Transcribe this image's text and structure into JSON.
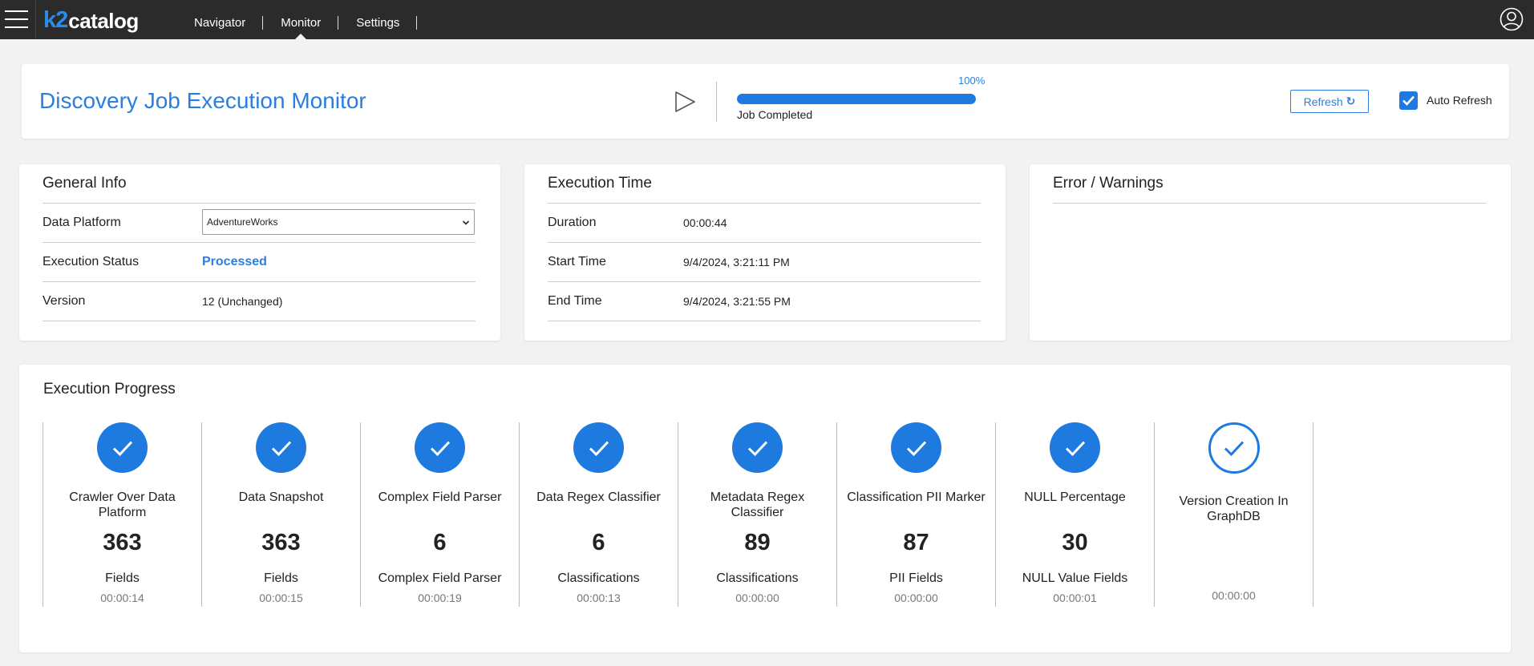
{
  "app": {
    "logo_k2": "k2",
    "logo_catalog": "catalog",
    "nav": [
      "Navigator",
      "Monitor",
      "Settings"
    ],
    "active_nav": "Monitor"
  },
  "header": {
    "title": "Discovery Job Execution Monitor",
    "progress_percent": 100,
    "progress_label": "100%",
    "status_label": "Job Completed",
    "refresh_label": "Refresh",
    "auto_refresh_label": "Auto Refresh",
    "auto_refresh_checked": true
  },
  "general_info": {
    "title": "General Info",
    "data_platform_label": "Data Platform",
    "data_platform_value": "AdventureWorks",
    "execution_status_label": "Execution Status",
    "execution_status_value": "Processed",
    "version_label": "Version",
    "version_value": "12 (Unchanged)"
  },
  "execution_time": {
    "title": "Execution Time",
    "duration_label": "Duration",
    "duration_value": "00:00:44",
    "start_label": "Start Time",
    "start_value": "9/4/2024, 3:21:11 PM",
    "end_label": "End Time",
    "end_value": "9/4/2024, 3:21:55 PM"
  },
  "errors": {
    "title": "Error / Warnings"
  },
  "execution_progress": {
    "title": "Execution Progress",
    "steps": [
      {
        "name": "Crawler Over Data Platform",
        "count": "363",
        "unit": "Fields",
        "time": "00:00:14",
        "state": "done"
      },
      {
        "name": "Data Snapshot",
        "count": "363",
        "unit": "Fields",
        "time": "00:00:15",
        "state": "done"
      },
      {
        "name": "Complex Field Parser",
        "count": "6",
        "unit": "Complex Field Parser",
        "time": "00:00:19",
        "state": "done"
      },
      {
        "name": "Data Regex Classifier",
        "count": "6",
        "unit": "Classifications",
        "time": "00:00:13",
        "state": "done"
      },
      {
        "name": "Metadata Regex Classifier",
        "count": "89",
        "unit": "Classifications",
        "time": "00:00:00",
        "state": "done"
      },
      {
        "name": "Classification PII Marker",
        "count": "87",
        "unit": "PII Fields",
        "time": "00:00:00",
        "state": "done"
      },
      {
        "name": "NULL Percentage",
        "count": "30",
        "unit": "NULL Value Fields",
        "time": "00:00:01",
        "state": "done"
      },
      {
        "name": "Version Creation In GraphDB",
        "count": "",
        "unit": "",
        "time": "00:00:00",
        "state": "outline"
      }
    ]
  },
  "colors": {
    "accent": "#1f7ae0",
    "topbar": "#2b2b2b",
    "background": "#f2f2f2"
  }
}
